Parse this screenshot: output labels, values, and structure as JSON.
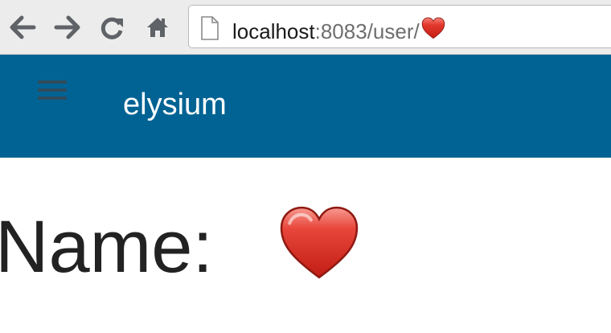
{
  "browser": {
    "back_icon": "arrow-left-icon",
    "forward_icon": "arrow-right-icon",
    "reload_icon": "reload-icon",
    "home_icon": "home-icon",
    "url_host": "localhost",
    "url_rest": ":8083/user/",
    "url_tail_icon": "red-heart-emoji"
  },
  "header": {
    "menu_icon": "hamburger-menu-icon",
    "title": "elysium",
    "background": "#006394"
  },
  "main": {
    "name_label": "Name:",
    "name_value_icon": "red-heart-emoji"
  }
}
